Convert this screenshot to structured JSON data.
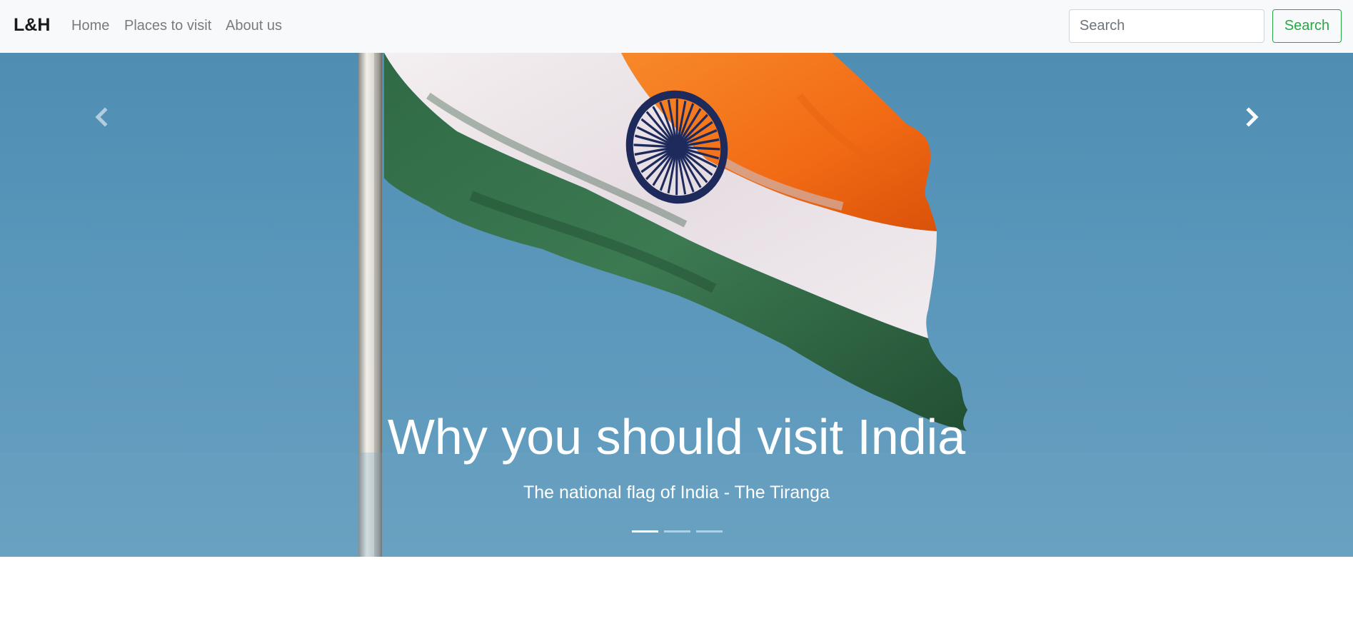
{
  "navbar": {
    "brand": "L&H",
    "links": [
      {
        "label": "Home"
      },
      {
        "label": "Places to visit"
      },
      {
        "label": "About us"
      }
    ],
    "search": {
      "placeholder": "Search",
      "button_label": "Search"
    },
    "background_color": "#f8f9fa",
    "accent_color": "#28a745"
  },
  "carousel": {
    "slides": [
      {
        "title": "Why you should visit India",
        "subtitle": "The national flag of India - The Tiranga",
        "image": "indian-flag-on-pole-against-blue-sky"
      }
    ],
    "active_index": 0,
    "indicator_count": 3,
    "controls": {
      "prev_icon": "chevron-left-icon",
      "next_icon": "chevron-right-icon"
    }
  }
}
